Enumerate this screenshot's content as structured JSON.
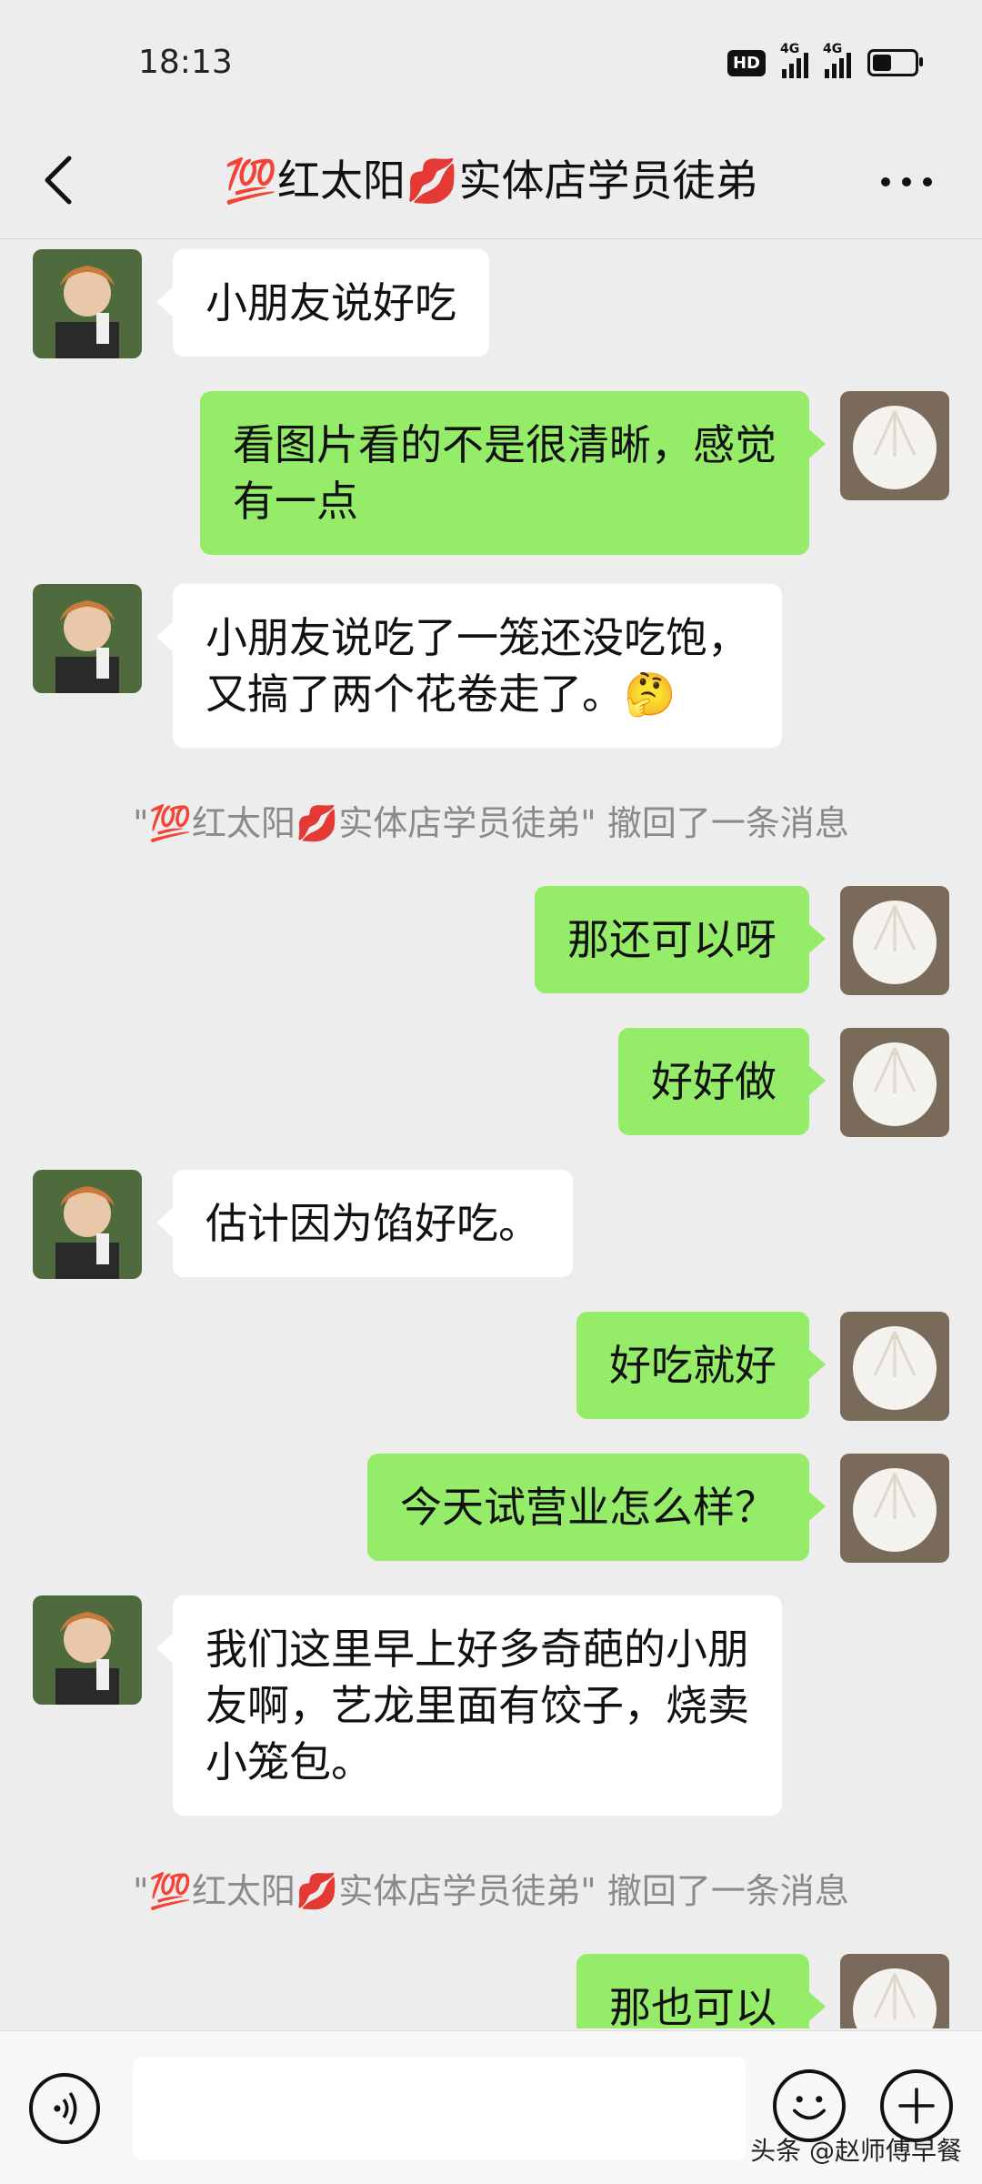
{
  "status_bar": {
    "time": "18:13",
    "hd_label": "HD",
    "network_1": "4G",
    "network_2": "4G",
    "battery_level": 0.45
  },
  "header": {
    "title": "💯红太阳💋实体店学员徒弟"
  },
  "messages": [
    {
      "side": "in",
      "text": "小朋友说好吃"
    },
    {
      "side": "out",
      "text": "看图片看的不是很清晰，感觉\n有一点"
    },
    {
      "side": "in",
      "text": "小朋友说吃了一笼还没吃饱，\n又搞了两个花卷走了。🤔"
    },
    {
      "side": "system",
      "text": "\"💯红太阳💋实体店学员徒弟\" 撤回了一条消息"
    },
    {
      "side": "out",
      "text": "那还可以呀"
    },
    {
      "side": "out",
      "text": "好好做"
    },
    {
      "side": "in",
      "text": "估计因为馅好吃。"
    },
    {
      "side": "out",
      "text": "好吃就好"
    },
    {
      "side": "out",
      "text": "今天试营业怎么样？"
    },
    {
      "side": "in",
      "text": "我们这里早上好多奇葩的小朋\n友啊，艺龙里面有饺子，烧卖\n小笼包。"
    },
    {
      "side": "system",
      "text": "\"💯红太阳💋实体店学员徒弟\" 撤回了一条消息"
    },
    {
      "side": "out",
      "text": "那也可以"
    }
  ],
  "watermark": "头条 @赵师傅早餐",
  "colors": {
    "background": "#ededed",
    "outgoing_bubble": "#95ec69",
    "incoming_bubble": "#ffffff",
    "system_text": "#8a8a8a"
  }
}
